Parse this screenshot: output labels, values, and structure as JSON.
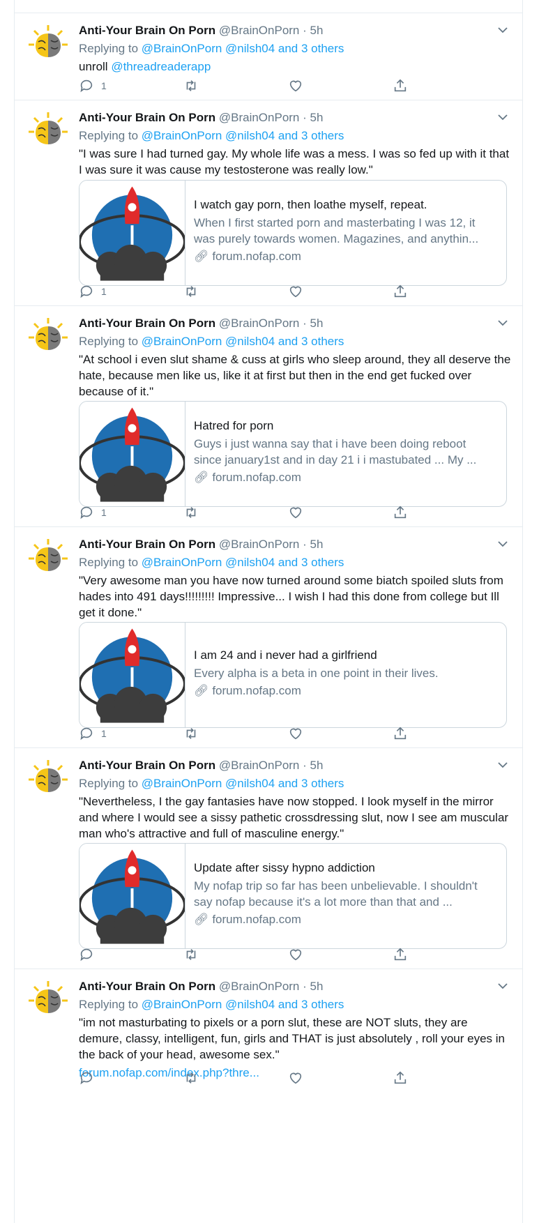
{
  "colors": {
    "accent": "#1da1f2",
    "muted": "#657786",
    "border": "#e6ecf0"
  },
  "tweets": [
    {
      "name": "Anti-Your Brain On Porn",
      "handle": "@BrainOnPorn",
      "dot": "·",
      "time": "5h",
      "reply_prefix": "Replying to",
      "reply_mentions": "@BrainOnPorn @nilsh04 and 3 others",
      "text": "unroll",
      "text_link": "@threadreaderapp",
      "reply_count": "1"
    },
    {
      "name": "Anti-Your Brain On Porn",
      "handle": "@BrainOnPorn",
      "dot": "·",
      "time": "5h",
      "reply_prefix": "Replying to",
      "reply_mentions": "@BrainOnPorn @nilsh04 and 3 others",
      "text": "\"I was sure I had turned gay. My whole life was a mess. I was so fed up with it that I was sure it was cause my testosterone was really low.\"",
      "card": {
        "title": "I watch gay porn, then loathe myself, repeat.",
        "desc": "When I first started porn and masterbating I was 12, it was purely towards women. Magazines, and anythin...",
        "domain": "forum.nofap.com"
      },
      "reply_count": "1"
    },
    {
      "name": "Anti-Your Brain On Porn",
      "handle": "@BrainOnPorn",
      "dot": "·",
      "time": "5h",
      "reply_prefix": "Replying to",
      "reply_mentions": "@BrainOnPorn @nilsh04 and 3 others",
      "text": "\"At school i even slut shame & cuss at girls who sleep around, they all deserve the hate, because men like us, like it at first but then in the end get fucked over because of it.\"",
      "card": {
        "title": "Hatred for porn",
        "desc": "Guys i just wanna say that i have been doing reboot since january1st and in day 21 i i mastubated ... My ...",
        "domain": "forum.nofap.com"
      },
      "reply_count": "1"
    },
    {
      "name": "Anti-Your Brain On Porn",
      "handle": "@BrainOnPorn",
      "dot": "·",
      "time": "5h",
      "reply_prefix": "Replying to",
      "reply_mentions": "@BrainOnPorn @nilsh04 and 3 others",
      "text": "\"Very awesome man you have now turned around some biatch spoiled sluts from hades into 491 days!!!!!!!!! Impressive... I wish I had this done from college but Ill get it done.\"",
      "card": {
        "title": "I am 24 and i never had a girlfriend",
        "desc": "Every alpha is a beta in one point in their lives.",
        "domain": "forum.nofap.com"
      },
      "reply_count": "1"
    },
    {
      "name": "Anti-Your Brain On Porn",
      "handle": "@BrainOnPorn",
      "dot": "·",
      "time": "5h",
      "reply_prefix": "Replying to",
      "reply_mentions": "@BrainOnPorn @nilsh04 and 3 others",
      "text": "\"Nevertheless, I the gay fantasies have now stopped. I look myself in the mirror and where I would see a sissy pathetic crossdressing slut, now I see am muscular man who's attractive and full of masculine energy.\"",
      "card": {
        "title": "Update after sissy hypno addiction",
        "desc": "My nofap trip so far has been unbelievable. I shouldn't say nofap because it's a lot more than that and ...",
        "domain": "forum.nofap.com"
      },
      "reply_count": ""
    },
    {
      "name": "Anti-Your Brain On Porn",
      "handle": "@BrainOnPorn",
      "dot": "·",
      "time": "5h",
      "reply_prefix": "Replying to",
      "reply_mentions": "@BrainOnPorn @nilsh04 and 3 others",
      "text": "\"im not masturbating to pixels or a porn slut, these are NOT sluts, they are demure, classy, intelligent, fun, girls and THAT is just absolutely , roll your eyes in the back of your head, awesome sex.\"",
      "text_link_below": "forum.nofap.com/index.php?thre...",
      "reply_count": ""
    }
  ]
}
